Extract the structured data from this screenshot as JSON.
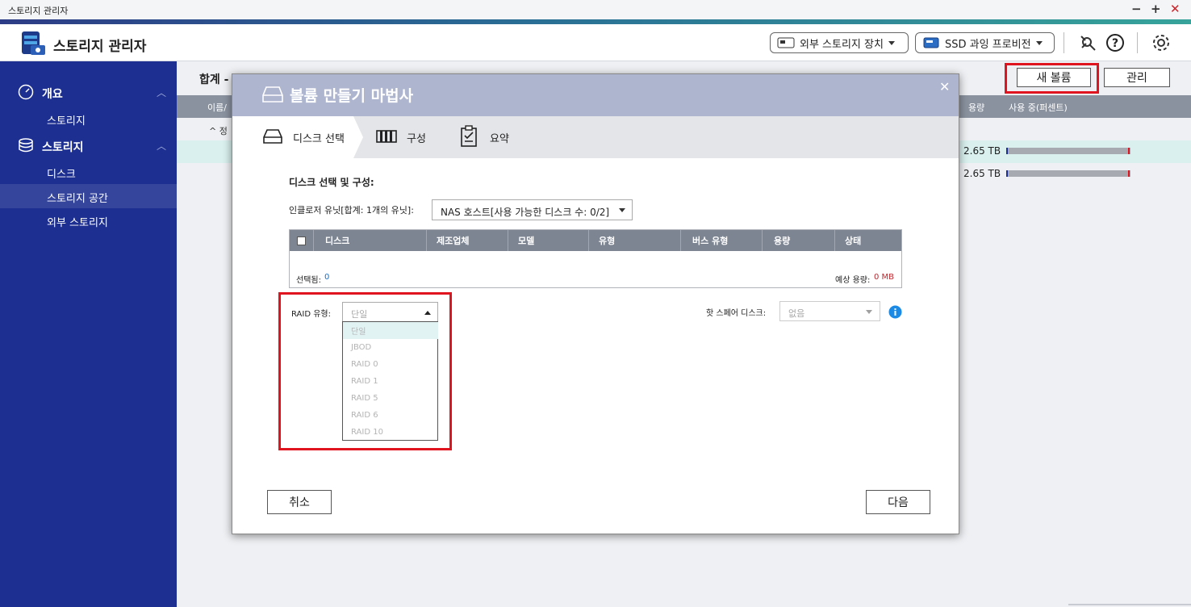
{
  "window": {
    "title": "스토리지 관리자"
  },
  "header": {
    "app_title": "스토리지 관리자",
    "external_storage_label": "외부 스토리지 장치",
    "ssd_label": "SSD 과잉 프로비전"
  },
  "sidebar": {
    "sections": [
      {
        "label": "개요",
        "items": [
          "스토리지"
        ]
      },
      {
        "label": "스토리지",
        "items": [
          "디스크",
          "스토리지 공간",
          "외부 스토리지"
        ]
      }
    ]
  },
  "main": {
    "summary_partial": "합계 -",
    "new_volume_button": "새 볼륨",
    "manage_button": "관리",
    "col_name_partial": "이름/",
    "col_capacity": "용량",
    "col_usage": "사용 중(퍼센트)",
    "group_partial": "정",
    "rows": [
      {
        "capacity": "2.65 TB",
        "usage_fraction": 0.98
      },
      {
        "capacity": "2.65 TB",
        "usage_fraction": 0.98
      }
    ]
  },
  "wizard": {
    "title": "볼륨 만들기 마법사",
    "steps": [
      "디스크 선택",
      "구성",
      "요약"
    ],
    "section_title": "디스크 선택 및 구성:",
    "enclosure_label": "인클로저 유닛[합계: 1개의 유닛]:",
    "enclosure_value": "NAS 호스트[사용 가능한 디스크 수: 0/2]",
    "table_columns": [
      "디스크",
      "제조업체",
      "모델",
      "유형",
      "버스 유형",
      "용량",
      "상태"
    ],
    "selected_label": "선택됨:",
    "selected_count": "0",
    "estimated_label": "예상 용량:",
    "estimated_value": "0 MB",
    "raid_label": "RAID 유형:",
    "raid_value": "단일",
    "raid_options": [
      "단일",
      "JBOD",
      "RAID 0",
      "RAID 1",
      "RAID 5",
      "RAID 6",
      "RAID 10"
    ],
    "hotspare_label": "핫 스페어 디스크:",
    "hotspare_value": "없음",
    "cancel_button": "취소",
    "next_button": "다음"
  },
  "colors": {
    "sidebar_bg": "#1d2f90",
    "highlight_red": "#e0141e",
    "wizard_header": "#aeb5cf",
    "table_header": "#7d8593",
    "info_blue": "#1a8ae6"
  }
}
